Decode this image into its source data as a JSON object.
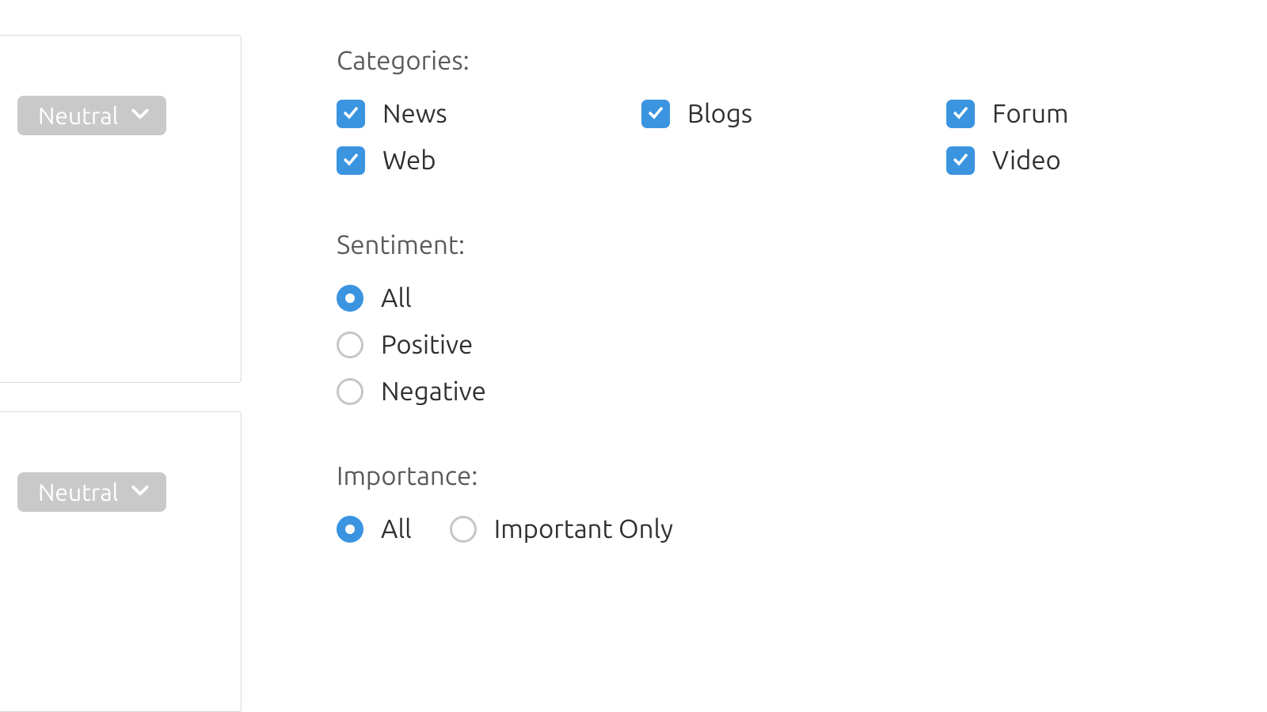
{
  "left": {
    "cards": [
      {
        "pill_label": "Neutral"
      },
      {
        "pill_label": "Neutral"
      }
    ]
  },
  "filters": {
    "categories": {
      "title": "Categories:",
      "items": [
        {
          "label": "News",
          "checked": true
        },
        {
          "label": "Blogs",
          "checked": true
        },
        {
          "label": "Forum",
          "checked": true
        },
        {
          "label": "Web",
          "checked": true
        },
        {
          "label": "",
          "checked": false
        },
        {
          "label": "Video",
          "checked": true
        }
      ]
    },
    "sentiment": {
      "title": "Sentiment:",
      "options": [
        {
          "label": "All",
          "selected": true
        },
        {
          "label": "Positive",
          "selected": false
        },
        {
          "label": "Negative",
          "selected": false
        }
      ]
    },
    "importance": {
      "title": "Importance:",
      "options": [
        {
          "label": "All",
          "selected": true
        },
        {
          "label": "Important Only",
          "selected": false
        }
      ]
    }
  }
}
